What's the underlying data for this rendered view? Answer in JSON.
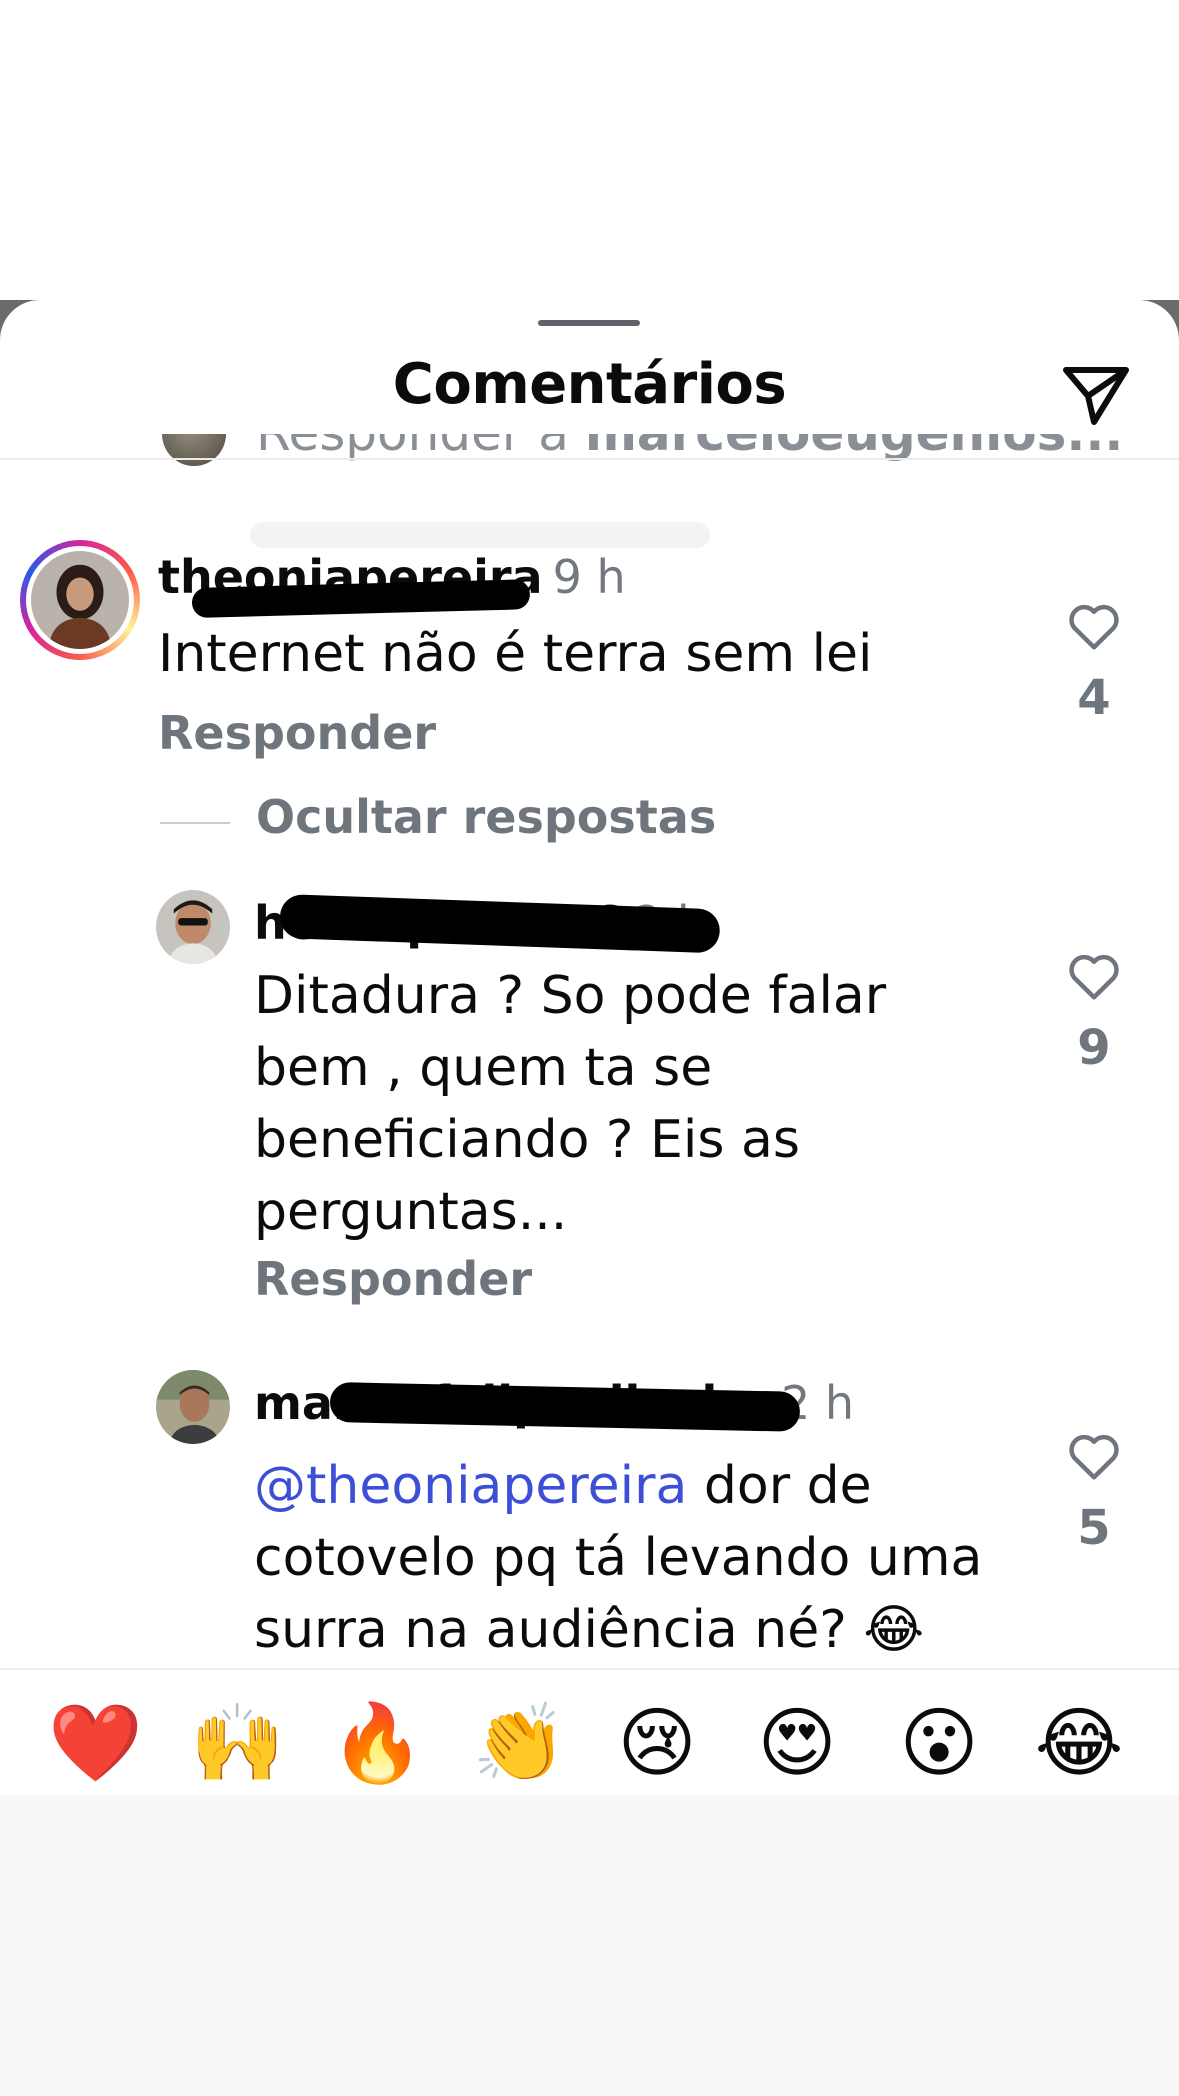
{
  "sheet": {
    "title": "Comentários",
    "send_icon": "paper-plane-icon"
  },
  "partial_reply": {
    "prefix": "Responder a ",
    "username": "marceloeugenios..."
  },
  "comments": [
    {
      "username": "theoniapereira",
      "time": "9 h",
      "text": "Internet não é terra sem lei",
      "reply_label": "Responder",
      "likes": "4",
      "hide_replies_label": "Ocultar respostas"
    },
    {
      "username": "henrique.br86",
      "time": "2 h",
      "text": "Ditadura ? So pode falar bem , quem ta se beneficiando ? Eis as perguntas...",
      "reply_label": "Responder",
      "likes": "9"
    },
    {
      "username": "marciofelipeoliveira",
      "time": "2 h",
      "mention": "@theoniapereira",
      "text": " dor de cotovelo pq tá levando uma surra na audiência né? 😂",
      "likes": "5"
    }
  ],
  "emoji_bar": [
    "❤️",
    "🙌",
    "🔥",
    "👏",
    "😢",
    "😍",
    "😮",
    "😂"
  ],
  "colors": {
    "mention": "#3d4fd6",
    "secondary_text": "#6f757d",
    "primary_text": "#0b0b0b"
  }
}
